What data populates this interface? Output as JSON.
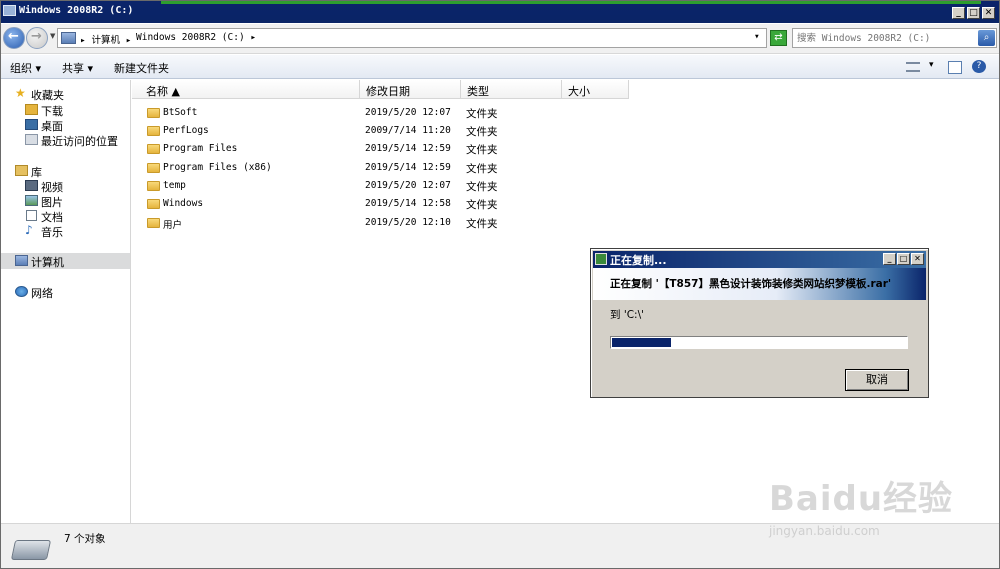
{
  "window": {
    "title": "Windows 2008R2 (C:)",
    "buttons": {
      "minimize": "_",
      "maximize": "□",
      "close": "✕"
    }
  },
  "address": {
    "crumbs": [
      "▸ 计算机 ▸",
      "Windows 2008R2 (C:) ▸"
    ],
    "dropdown": "▾",
    "search_placeholder": "搜索 Windows 2008R2 (C:)"
  },
  "toolbar": {
    "organize": "组织 ▾",
    "share": "共享 ▾",
    "new_folder": "新建文件夹"
  },
  "sidebar": {
    "favorites": {
      "label": "收藏夹",
      "items": [
        "下载",
        "桌面",
        "最近访问的位置"
      ]
    },
    "libraries": {
      "label": "库",
      "items": [
        "视频",
        "图片",
        "文档",
        "音乐"
      ]
    },
    "computer": "计算机",
    "network": "网络"
  },
  "columns": {
    "name": "名称 ▲",
    "modified": "修改日期",
    "type": "类型",
    "size": "大小"
  },
  "files": [
    {
      "name": "BtSoft",
      "date": "2019/5/20 12:07",
      "type": "文件夹"
    },
    {
      "name": "PerfLogs",
      "date": "2009/7/14 11:20",
      "type": "文件夹"
    },
    {
      "name": "Program Files",
      "date": "2019/5/14 12:59",
      "type": "文件夹"
    },
    {
      "name": "Program Files (x86)",
      "date": "2019/5/14 12:59",
      "type": "文件夹"
    },
    {
      "name": "temp",
      "date": "2019/5/20 12:07",
      "type": "文件夹"
    },
    {
      "name": "Windows",
      "date": "2019/5/14 12:58",
      "type": "文件夹"
    },
    {
      "name": "用户",
      "date": "2019/5/20 12:10",
      "type": "文件夹"
    }
  ],
  "status": {
    "count": "7 个对象"
  },
  "dialog": {
    "title": "正在复制...",
    "message": "正在复制 '【T857】黑色设计装饰装修类网站织梦模板.rar'",
    "destination": "到 'C:\\'",
    "progress_fraction": 0.2,
    "cancel": "取消"
  },
  "watermark": {
    "logo": "Baidu经验",
    "url": "jingyan.baidu.com"
  },
  "colors": {
    "titlebar": "#0b246a",
    "progress": "#0a246a",
    "selected_nav": "#dadbdc"
  }
}
